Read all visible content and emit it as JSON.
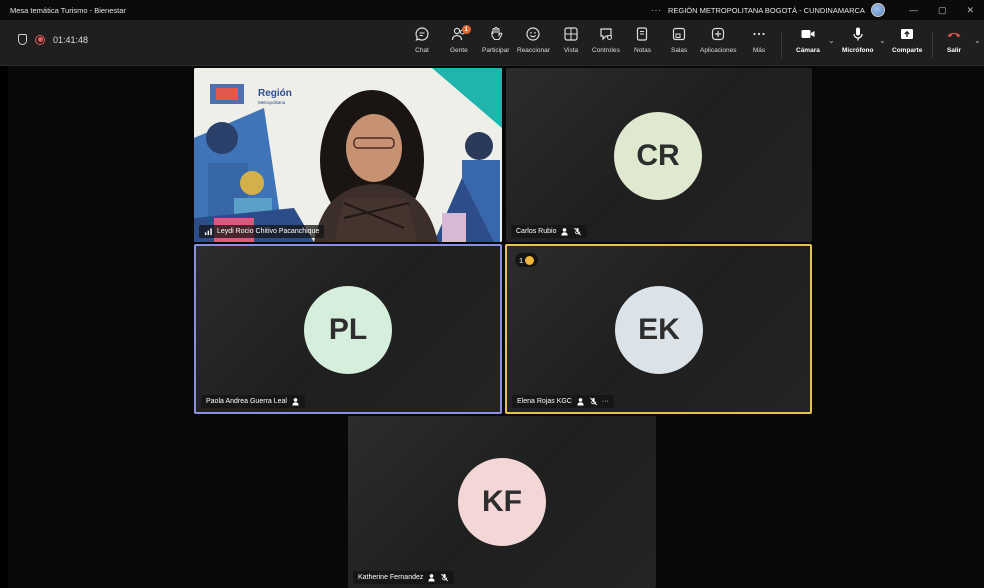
{
  "window": {
    "title": "Mesa temática Turismo - Bienestar",
    "org_name": "REGIÓN METROPOLITANA BOGOTÁ - CUNDINAMARCA",
    "more": "···",
    "min": "—",
    "restore": "▢",
    "close": "✕"
  },
  "meeting": {
    "timer": "01:41:48"
  },
  "toolbar": {
    "chat": "Chat",
    "people": "Gente",
    "people_badge": "1",
    "raise": "Participar",
    "react": "Reaccionar",
    "view": "Vista",
    "controls": "Controles",
    "notes": "Notas",
    "rooms": "Salas",
    "apps": "Aplicaciones",
    "more": "Más",
    "camera": "Cámara",
    "mic": "Micrófono",
    "share": "Comparte",
    "leave": "Salir",
    "chevron": "⌄"
  },
  "participants": [
    {
      "name": "Leydi Rocio Chitivo Pacanchique",
      "initials": ""
    },
    {
      "name": "Carlos Rubio",
      "initials": "CR"
    },
    {
      "name": "Paola Andrea Guerra Leal",
      "initials": "PL"
    },
    {
      "name": "Elena Rojas KGC",
      "initials": "EK",
      "hand_count": "1",
      "more": "···"
    },
    {
      "name": "Katherine Fernandez",
      "initials": "KF"
    }
  ],
  "video": {
    "logo_text": "Región",
    "logo_sub": "Metropolitana"
  },
  "colors": {
    "accent_border": "#8a8fe0",
    "speaking_border": "#e8c14f",
    "avatar_cr": "#dfe9d0",
    "avatar_pl": "#d6eedc",
    "avatar_ek": "#dbe2e8",
    "avatar_kf": "#f3d6d6",
    "leave_red": "#d9534f"
  }
}
